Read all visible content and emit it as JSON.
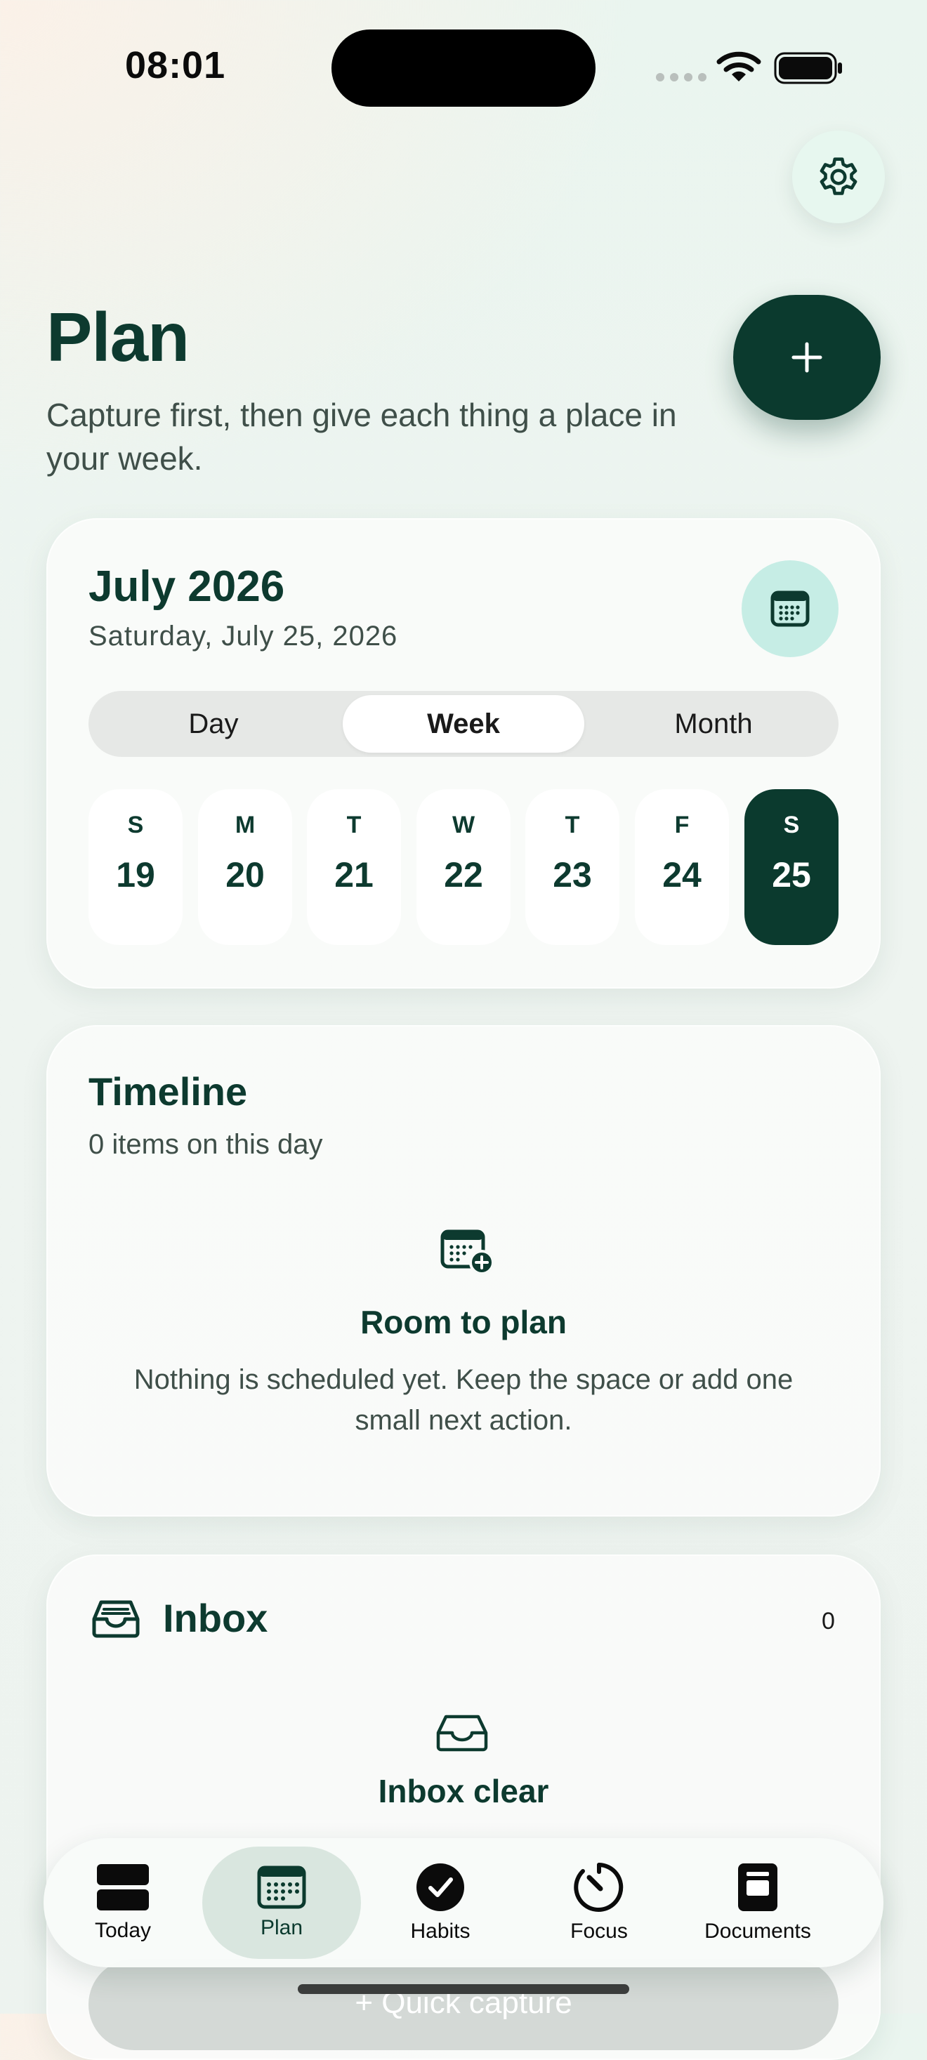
{
  "status_bar": {
    "time": "08:01"
  },
  "header": {
    "title": "Plan",
    "subtitle": "Capture first, then give each thing a place in your week.",
    "add_label": "+"
  },
  "calendar": {
    "month": "July 2026",
    "date": "Saturday, July 25, 2026",
    "segments": [
      "Day",
      "Week",
      "Month"
    ],
    "active_segment": "Week",
    "days": [
      {
        "weekday": "S",
        "num": "19"
      },
      {
        "weekday": "M",
        "num": "20"
      },
      {
        "weekday": "T",
        "num": "21"
      },
      {
        "weekday": "W",
        "num": "22"
      },
      {
        "weekday": "T",
        "num": "23"
      },
      {
        "weekday": "F",
        "num": "24"
      },
      {
        "weekday": "S",
        "num": "25"
      }
    ],
    "selected_day": "25"
  },
  "timeline": {
    "title": "Timeline",
    "subtitle": "0 items on this day",
    "empty_title": "Room to plan",
    "empty_text": "Nothing is scheduled yet. Keep the space or add one small next action."
  },
  "inbox": {
    "title": "Inbox",
    "count": "0",
    "empty_title": "Inbox clear"
  },
  "quick_capture": {
    "label": "+  Quick capture"
  },
  "tabs": [
    {
      "label": "Today",
      "icon": "today-icon"
    },
    {
      "label": "Plan",
      "icon": "calendar-grid-icon"
    },
    {
      "label": "Habits",
      "icon": "checkmark-circle-icon"
    },
    {
      "label": "Focus",
      "icon": "timer-icon"
    },
    {
      "label": "Documents",
      "icon": "document-icon"
    }
  ],
  "active_tab": "Plan",
  "colors": {
    "accent_dark": "#0b3a2e",
    "accent_mint": "#c6ede5",
    "text_muted": "#3f4f49"
  }
}
